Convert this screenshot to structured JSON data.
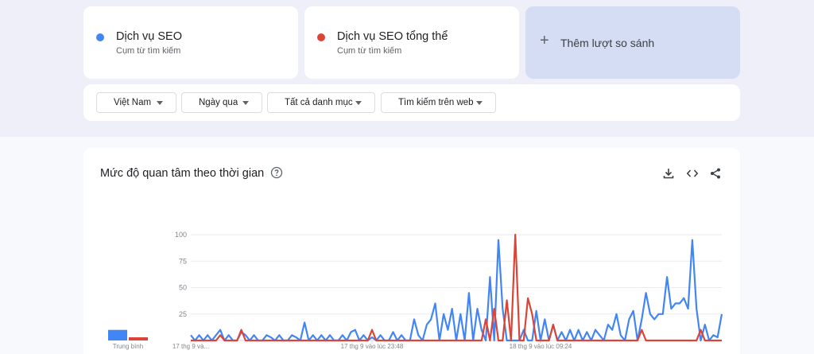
{
  "terms": [
    {
      "name": "Dịch vụ SEO",
      "sub": "Cụm từ tìm kiếm",
      "color": "#4285f4"
    },
    {
      "name": "Dịch vụ SEO tổng thể",
      "sub": "Cụm từ tìm kiếm",
      "color": "#db4437"
    }
  ],
  "compare": {
    "label": "Thêm lượt so sánh",
    "icon": "plus-icon"
  },
  "filters": [
    {
      "label": "Việt Nam"
    },
    {
      "label": "Ngày qua"
    },
    {
      "label": "Tất cả danh mục"
    },
    {
      "label": "Tìm kiếm trên web"
    }
  ],
  "chart_card": {
    "title": "Mức độ quan tâm theo thời gian",
    "help_icon": "help-circle-icon",
    "tool_icons": [
      "download-icon",
      "embed-code-icon",
      "share-icon"
    ]
  },
  "chart_data": {
    "type": "line",
    "ylim": [
      0,
      100
    ],
    "yticks": [
      100,
      75,
      50,
      25
    ],
    "grid": true,
    "x_tick_labels": [
      "17 thg 9 và...",
      "17 thg 9 vào lúc 23:48",
      "18 thg 9 vào lúc 09:24"
    ],
    "x_tick_positions": [
      0,
      43,
      83
    ],
    "average": {
      "label": "Trung bình",
      "values": [
        10,
        3
      ]
    },
    "series": [
      {
        "color": "#4285f4",
        "values": [
          5,
          0,
          5,
          0,
          5,
          0,
          5,
          10,
          0,
          5,
          0,
          0,
          8,
          5,
          0,
          5,
          0,
          0,
          5,
          3,
          0,
          5,
          0,
          0,
          5,
          3,
          0,
          17,
          0,
          5,
          0,
          5,
          0,
          5,
          0,
          0,
          5,
          0,
          8,
          10,
          0,
          5,
          0,
          3,
          0,
          5,
          0,
          0,
          8,
          0,
          5,
          0,
          0,
          20,
          5,
          0,
          15,
          20,
          35,
          0,
          25,
          10,
          30,
          0,
          25,
          0,
          45,
          0,
          30,
          10,
          0,
          60,
          0,
          95,
          30,
          0,
          0,
          0,
          0,
          10,
          0,
          0,
          28,
          0,
          20,
          0,
          15,
          0,
          8,
          0,
          10,
          0,
          10,
          0,
          8,
          0,
          10,
          5,
          0,
          15,
          10,
          25,
          5,
          0,
          20,
          28,
          0,
          20,
          45,
          25,
          20,
          25,
          25,
          60,
          30,
          35,
          35,
          40,
          30,
          95,
          30,
          0,
          15,
          0,
          5,
          3,
          25
        ]
      },
      {
        "color": "#db4437",
        "values": [
          0,
          0,
          0,
          0,
          0,
          0,
          0,
          5,
          0,
          0,
          0,
          0,
          10,
          0,
          0,
          0,
          0,
          0,
          0,
          0,
          0,
          0,
          0,
          0,
          0,
          0,
          0,
          0,
          0,
          0,
          0,
          0,
          0,
          0,
          0,
          0,
          0,
          0,
          0,
          0,
          0,
          0,
          0,
          10,
          0,
          0,
          0,
          0,
          0,
          0,
          0,
          0,
          0,
          0,
          0,
          0,
          0,
          0,
          0,
          0,
          0,
          0,
          0,
          0,
          0,
          0,
          0,
          0,
          0,
          0,
          20,
          0,
          30,
          0,
          0,
          38,
          0,
          100,
          0,
          0,
          40,
          25,
          0,
          0,
          0,
          0,
          15,
          0,
          0,
          0,
          0,
          0,
          0,
          0,
          0,
          0,
          0,
          0,
          0,
          0,
          0,
          0,
          0,
          0,
          0,
          0,
          0,
          10,
          0,
          0,
          0,
          0,
          0,
          0,
          0,
          0,
          0,
          0,
          0,
          0,
          0,
          10,
          0,
          0,
          0,
          0,
          0
        ]
      }
    ]
  }
}
